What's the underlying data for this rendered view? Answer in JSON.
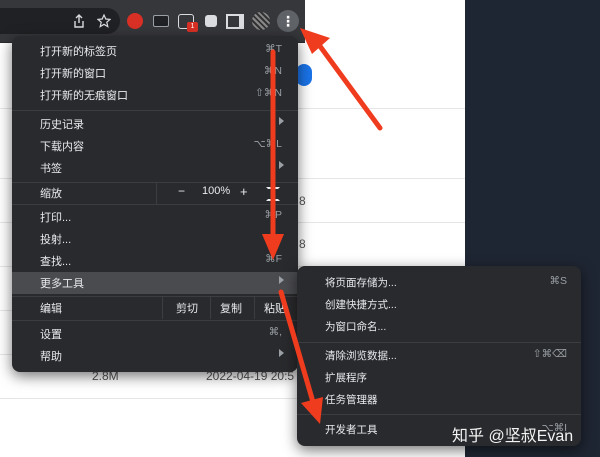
{
  "menu": {
    "items": [
      {
        "label": "打开新的标签页",
        "shortcut": "⌘T"
      },
      {
        "label": "打开新的窗口",
        "shortcut": "⌘N"
      },
      {
        "label": "打开新的无痕窗口",
        "shortcut": "⇧⌘N"
      },
      {
        "label": "历史记录",
        "shortcut": ""
      },
      {
        "label": "下载内容",
        "shortcut": "⌥⌘L"
      },
      {
        "label": "书签",
        "shortcut": ""
      },
      {
        "label": "打印...",
        "shortcut": "⌘P"
      },
      {
        "label": "投射...",
        "shortcut": ""
      },
      {
        "label": "查找...",
        "shortcut": "⌘F"
      },
      {
        "label": "更多工具",
        "shortcut": ""
      },
      {
        "label": "设置",
        "shortcut": "⌘,"
      },
      {
        "label": "帮助",
        "shortcut": ""
      }
    ],
    "zoom": {
      "label": "缩放",
      "minus": "−",
      "level": "100%",
      "plus": "+"
    },
    "edit": {
      "label": "编辑",
      "cut": "剪切",
      "copy": "复制",
      "paste": "粘贴"
    }
  },
  "submenu": {
    "items": [
      {
        "label": "将页面存储为...",
        "shortcut": "⌘S"
      },
      {
        "label": "创建快捷方式...",
        "shortcut": ""
      },
      {
        "label": "为窗口命名...",
        "shortcut": ""
      },
      {
        "label": "清除浏览数据...",
        "shortcut": "⇧⌘⌫"
      },
      {
        "label": "扩展程序",
        "shortcut": ""
      },
      {
        "label": "任务管理器",
        "shortcut": ""
      },
      {
        "label": "开发者工具",
        "shortcut": "⌥⌘I"
      }
    ]
  },
  "toolbar": {
    "share_icon": "share-icon",
    "star_icon": "bookmark-star-icon",
    "ext_badge": "1",
    "kebab_glyph": "⋮"
  },
  "background": {
    "file_size": "2.8M",
    "file_date": "2022-04-19 20:5",
    "digits": [
      "8",
      "8",
      "8"
    ]
  },
  "watermark": "知乎 @坚叔Evan",
  "colors": {
    "menu_bg": "#292a2d",
    "highlight": "#4a4b4f",
    "arrow": "#f03c1e",
    "dark_panel": "#1f2633"
  }
}
